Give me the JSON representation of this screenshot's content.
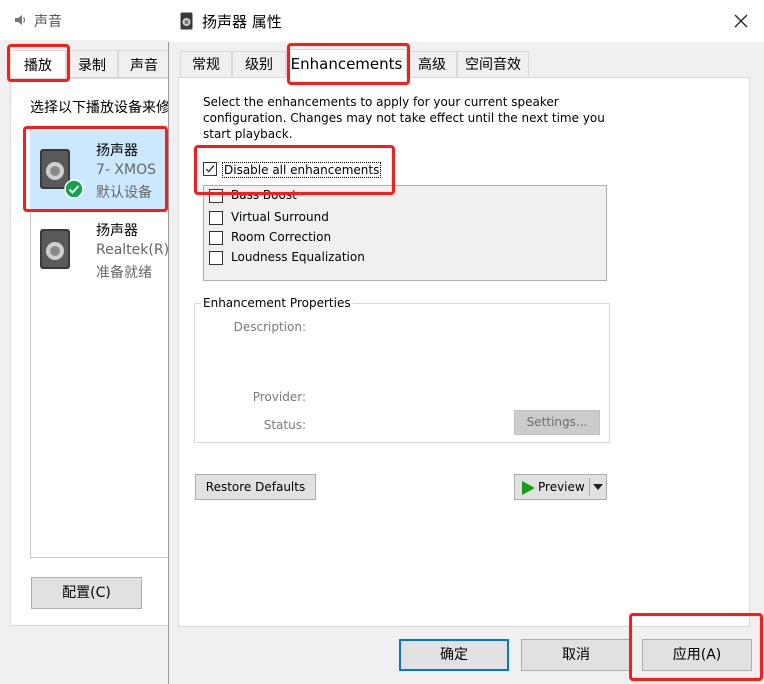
{
  "background_window": {
    "title": "声音",
    "tabs": [
      "播放",
      "录制",
      "声音"
    ],
    "instruction": "选择以下播放设备来修",
    "devices": [
      {
        "name": "扬声器",
        "description": "7- XMOS",
        "status": "默认设备",
        "icon": "speaker-icon",
        "default_badge": "check-icon"
      },
      {
        "name": "扬声器",
        "description": "Realtek(R)",
        "status": "准备就绪",
        "icon": "speaker-icon"
      }
    ],
    "config_button": "配置(C)"
  },
  "dialog": {
    "title": "扬声器 属性",
    "tabs": [
      "常规",
      "级别",
      "Enhancements",
      "高级",
      "空间音效"
    ],
    "active_tab": "Enhancements",
    "description": "Select the enhancements to apply for your current speaker configuration. Changes may not take effect until the next time you start playback.",
    "disable_all": {
      "label": "Disable all enhancements",
      "checked": true
    },
    "enhancements": [
      {
        "label": "Bass Boost",
        "checked": false
      },
      {
        "label": "Virtual Surround",
        "checked": false
      },
      {
        "label": "Room Correction",
        "checked": false
      },
      {
        "label": "Loudness Equalization",
        "checked": false
      }
    ],
    "properties": {
      "legend": "Enhancement Properties",
      "description_label": "Description:",
      "provider_label": "Provider:",
      "status_label": "Status:",
      "settings_button": "Settings..."
    },
    "restore_defaults": "Restore Defaults",
    "preview": "Preview",
    "buttons": {
      "ok": "确定",
      "cancel": "取消",
      "apply": "应用(A)"
    }
  },
  "colors": {
    "highlight_red": "#ff1a1a",
    "selection_blue": "#cce8ff",
    "focus_blue": "#0078d7",
    "check_green": "#16a34a",
    "play_green": "#1a9e1a"
  }
}
